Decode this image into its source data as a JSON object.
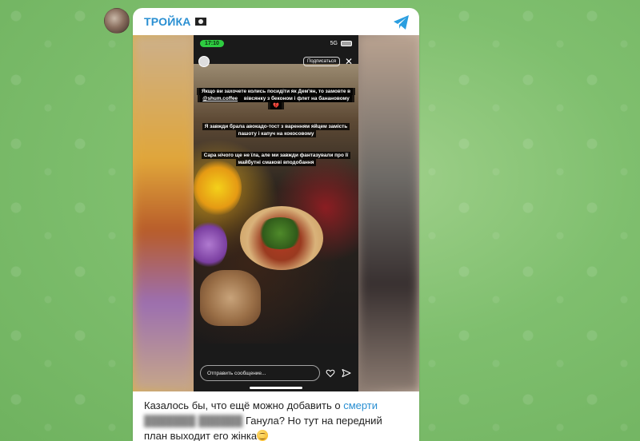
{
  "channel": {
    "name": "ТРОЙКА",
    "flag_icon": "pirate-flag-icon",
    "share_icon": "telegram-share-icon",
    "accent": "#2a8fd2"
  },
  "story": {
    "status_time": "17:10",
    "network": "5G",
    "battery_icon": "battery-icon",
    "subscribe_label": "Подписаться",
    "close_icon": "close-icon",
    "captions": [
      {
        "before": "Якщо ви захочете колись посидіти як Дем'ян, то замовте в ",
        "mention": "@shum.coffee",
        "after": " вівсянку з беконом і флет на банановому 💔"
      },
      {
        "text": "Я завжди брала авокадо-тост з варенням яйцем замість пашоту і капуч на кокосовому"
      },
      {
        "text": "Сара нічого ще не їла, але ми завжди фантазували про її майбутні смакові вподобання"
      }
    ],
    "reply_placeholder": "Отправить сообщение...",
    "heart_icon": "heart-icon",
    "send_icon": "send-icon"
  },
  "message": {
    "text_before": "Казалось бы, что ещё можно добавить о ",
    "link_text": "смерти",
    "blurred_text": "███████ ██████",
    "text_after": " Ганула? Но тут на передний план выходит его жінка",
    "emoji_icon": "grinning-emoji-icon"
  }
}
